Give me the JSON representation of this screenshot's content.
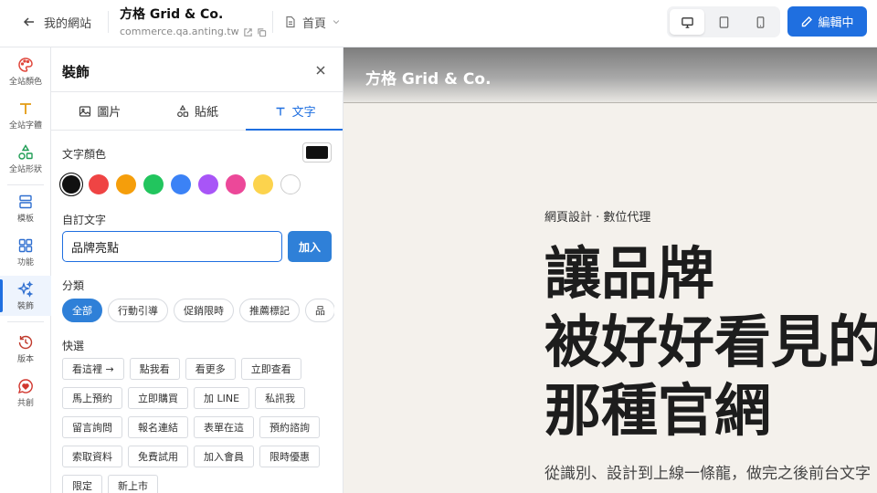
{
  "topbar": {
    "back_label": "我的網站",
    "site_name": "方格 Grid & Co.",
    "site_url": "commerce.qa.anting.tw",
    "page_select": "首頁",
    "edit_label": "編輯中",
    "accent": "#1f6fe0"
  },
  "rail": {
    "items": [
      {
        "label": "全站顏色",
        "icon": "palette-icon"
      },
      {
        "label": "全站字體",
        "icon": "type-icon"
      },
      {
        "label": "全站形狀",
        "icon": "shapes-icon"
      },
      {
        "label": "模板",
        "icon": "template-icon"
      },
      {
        "label": "功能",
        "icon": "blocks-icon"
      },
      {
        "label": "裝飾",
        "icon": "sparkles-icon"
      },
      {
        "label": "版本",
        "icon": "history-icon"
      },
      {
        "label": "共創",
        "icon": "heart-chat-icon"
      }
    ]
  },
  "panel": {
    "title": "裝飾",
    "tabs": [
      {
        "label": "圖片",
        "icon": "image-icon"
      },
      {
        "label": "貼紙",
        "icon": "shapes-icon"
      },
      {
        "label": "文字",
        "icon": "text-icon"
      }
    ],
    "text_color_label": "文字顏色",
    "current_color": "#111111",
    "swatches": [
      "#111111",
      "#ef4444",
      "#f59e0b",
      "#22c55e",
      "#3b82f6",
      "#a855f7",
      "#ec4899",
      "#fcd34d",
      "#ffffff"
    ],
    "custom_text_label": "自訂文字",
    "custom_text_value": "品牌亮點",
    "add_label": "加入",
    "category_label": "分類",
    "categories": [
      "全部",
      "行動引導",
      "促銷限時",
      "推薦標記",
      "品"
    ],
    "quick_label": "快選",
    "quick_items": [
      "看這裡 →",
      "點我看",
      "看更多",
      "立即查看",
      "馬上預約",
      "立即購買",
      "加 LINE",
      "私訊我",
      "留言詢問",
      "報名連結",
      "表單在這",
      "預約諮詢",
      "索取資料",
      "免費試用",
      "加入會員",
      "限時優惠",
      "限定",
      "新上市"
    ]
  },
  "preview": {
    "brand": "方格 Grid & Co.",
    "eyebrow": "網頁設計 · 數位代理",
    "headline": [
      "讓品牌",
      "被好好看見的",
      "那種官網"
    ],
    "body": "從識別、設計到上線一條龍，做完之後前台文字"
  }
}
